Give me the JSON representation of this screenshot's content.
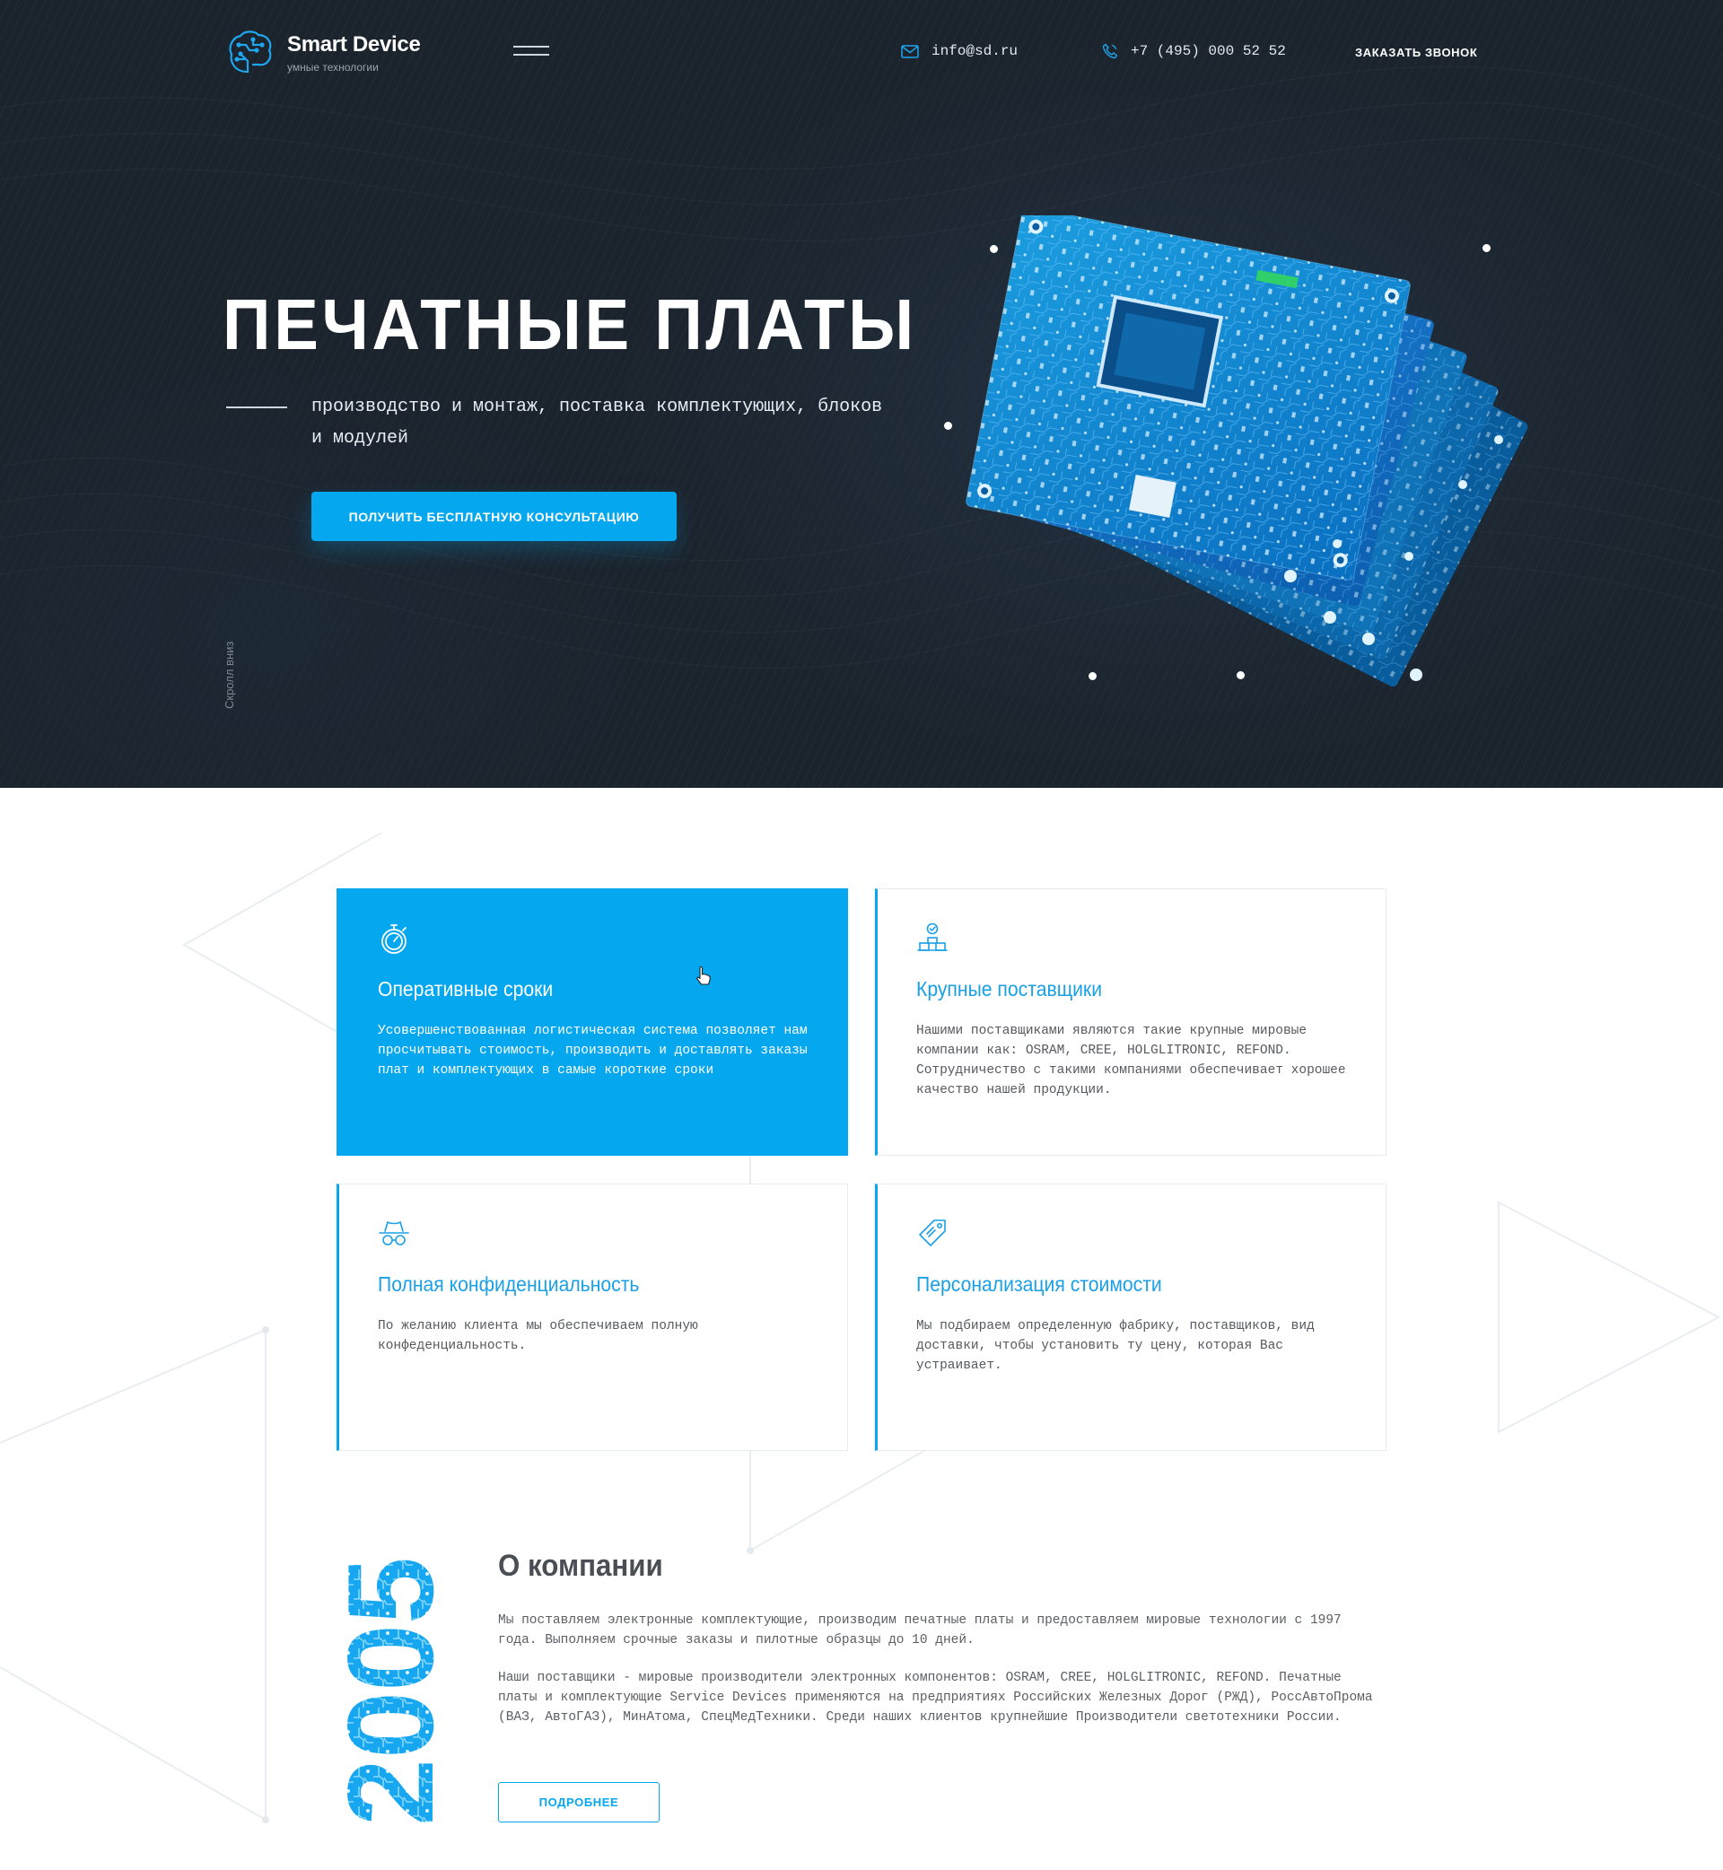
{
  "header": {
    "logo_title": "Smart Device",
    "logo_subtitle": "умные технологии",
    "email": "info@sd.ru",
    "phone": "+7 (495) 000 52 52",
    "callback_label": "ЗАКАЗАТЬ ЗВОНОК"
  },
  "hero": {
    "title": "ПЕЧАТНЫЕ ПЛАТЫ",
    "subtitle": "производство и монтаж, поставка комплектующих, блоков и модулей",
    "cta_label": "ПОЛУЧИТЬ БЕСПЛАТНУЮ КОНСУЛЬТАЦИЮ",
    "scroll_hint": "Скролл вниз"
  },
  "features": [
    {
      "icon": "stopwatch-icon",
      "title": "Оперативные сроки",
      "text": "Усовершенствованная логистическая система позволяет нам просчитывать стоимость, производить и доставлять заказы плат и комплектующих в самые короткие сроки",
      "active": true
    },
    {
      "icon": "suppliers-icon",
      "title": "Крупные поставщики",
      "text": "Нашими поставщиками являются такие крупные мировые компании как: OSRAM, CREE, HOLGLITRONIC, REFOND. Сотрудничество с такими компаниями обеспечивает хорошее качество нашей продукции.",
      "active": false
    },
    {
      "icon": "spy-icon",
      "title": "Полная конфиденциальность",
      "text": "По желанию клиента  мы обеспечиваем полную конфеденциальность.",
      "active": false
    },
    {
      "icon": "price-tag-icon",
      "title": "Персонализация стоимости",
      "text": "Мы  подбираем определенную фабрику, поставщиков, вид доставки, чтобы установить ту цену, которая Вас устраивает.",
      "active": false
    }
  ],
  "about": {
    "year": "2005",
    "title": "О компании",
    "paragraph_1": "Мы поставляем электронные комплектующие, производим печатные платы и предоставляем мировые технологии с 1997 года. Выполняем срочные заказы и пилотные образцы до 10 дней.",
    "paragraph_2": "Наши поставщики - мировые производители электронных компонентов: OSRAM, CREE, HOLGLITRONIC, REFOND. Печатные платы и комплектующие Service Devices применяются на предприятиях Российских Железных Дорог (РЖД), РоссАвтоПрома (ВАЗ, АвтоГАЗ), МинАтома, СпецМедТехники. Среди наших клиентов крупнейшие Производители светотехники России.",
    "more_label": "ПОДРОБНЕЕ"
  },
  "colors": {
    "accent": "#05a8ef",
    "hero_bg": "#1b232c",
    "text": "#5a5f65",
    "card_border": "#e6ebef"
  }
}
